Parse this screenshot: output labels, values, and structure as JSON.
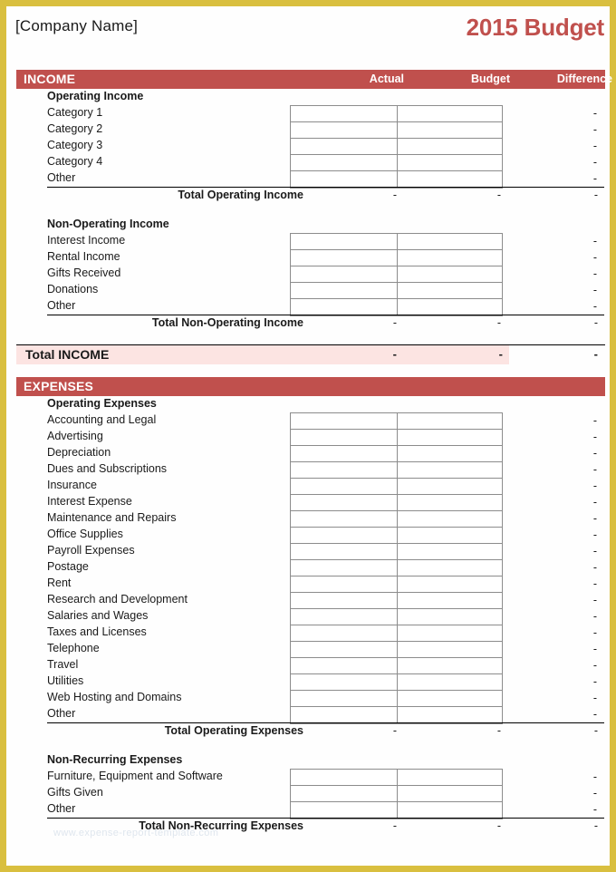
{
  "header": {
    "company_name": "[Company Name]",
    "budget_title": "2015 Budget",
    "title_color": "#c0504d"
  },
  "columns": {
    "actual": "Actual",
    "budget": "Budget",
    "difference": "Difference"
  },
  "dash": "-",
  "watermark": "www.expense-report-template.com",
  "income": {
    "banner": "INCOME",
    "groups": [
      {
        "title": "Operating Income",
        "items": [
          "Category 1",
          "Category 2",
          "Category 3",
          "Category 4",
          "Other"
        ],
        "total_label": "Total Operating Income",
        "total_actual": "-",
        "total_budget": "-",
        "total_difference": "-"
      },
      {
        "title": "Non-Operating Income",
        "items": [
          "Interest Income",
          "Rental Income",
          "Gifts Received",
          "Donations",
          "Other"
        ],
        "total_label": "Total Non-Operating Income",
        "total_actual": "-",
        "total_budget": "-",
        "total_difference": "-"
      }
    ],
    "grand_total": {
      "label": "Total INCOME",
      "actual": "-",
      "budget": "-",
      "difference": "-",
      "fill_color": "#fce4e2"
    }
  },
  "expenses": {
    "banner": "EXPENSES",
    "groups": [
      {
        "title": "Operating Expenses",
        "items": [
          "Accounting and Legal",
          "Advertising",
          "Depreciation",
          "Dues and Subscriptions",
          "Insurance",
          "Interest Expense",
          "Maintenance and Repairs",
          "Office Supplies",
          "Payroll Expenses",
          "Postage",
          "Rent",
          "Research and Development",
          "Salaries and Wages",
          "Taxes and Licenses",
          "Telephone",
          "Travel",
          "Utilities",
          "Web Hosting and Domains",
          "Other"
        ],
        "total_label": "Total Operating Expenses",
        "total_actual": "-",
        "total_budget": "-",
        "total_difference": "-"
      },
      {
        "title": "Non-Recurring Expenses",
        "items": [
          "Furniture, Equipment and Software",
          "Gifts Given",
          "Other"
        ],
        "total_label": "Total Non-Recurring Expenses",
        "total_actual": "-",
        "total_budget": "-",
        "total_difference": "-"
      }
    ]
  },
  "theme": {
    "banner_color": "#c0504d",
    "frame_color": "#d9bf3f"
  }
}
